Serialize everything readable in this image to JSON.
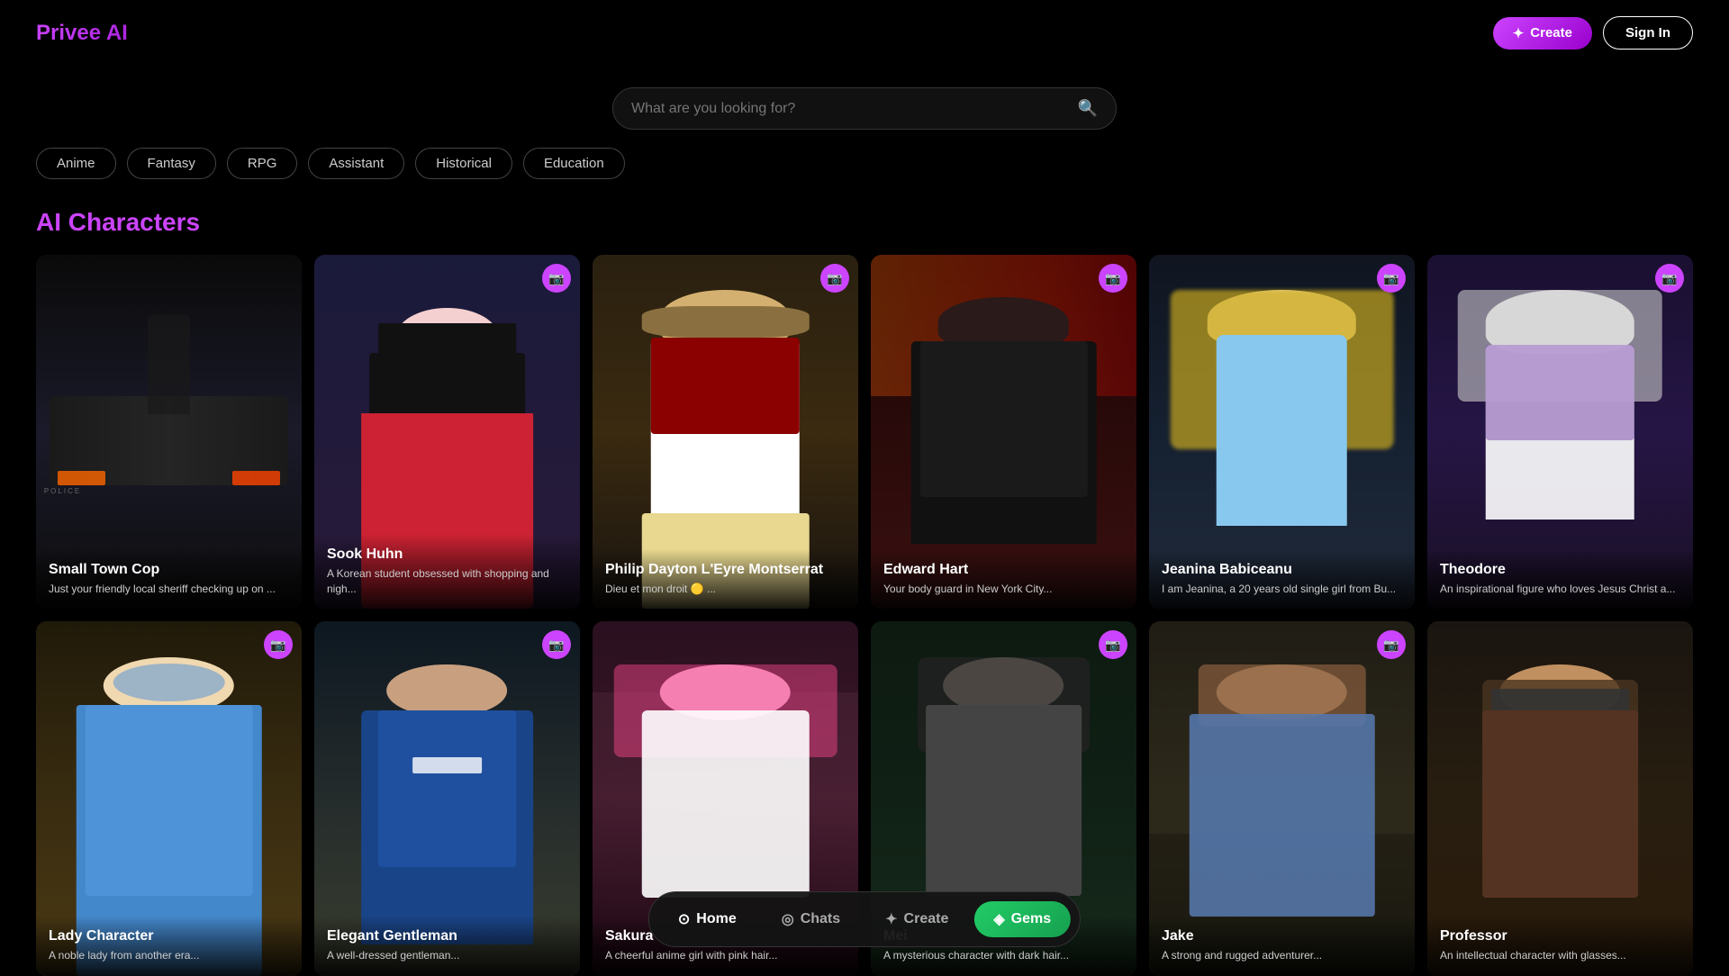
{
  "app": {
    "title": "Privee AI"
  },
  "header": {
    "logo": "Privee AI",
    "create_label": "Create",
    "sign_in_label": "Sign In"
  },
  "search": {
    "placeholder": "What are you looking for?"
  },
  "filters": [
    {
      "id": "anime",
      "label": "Anime"
    },
    {
      "id": "fantasy",
      "label": "Fantasy"
    },
    {
      "id": "rpg",
      "label": "RPG"
    },
    {
      "id": "assistant",
      "label": "Assistant"
    },
    {
      "id": "historical",
      "label": "Historical"
    },
    {
      "id": "education",
      "label": "Education"
    }
  ],
  "section_title": "AI Characters",
  "characters_row1": [
    {
      "id": "small-town-cop",
      "name": "Small Town Cop",
      "description": "Just your friendly local sheriff checking up on ...",
      "has_camera": false,
      "bg_class": "card-bg-1"
    },
    {
      "id": "sook-huhn",
      "name": "Sook Huhn",
      "description": "A Korean student obsessed with shopping and nigh...",
      "has_camera": true,
      "bg_class": "card-bg-2"
    },
    {
      "id": "philip-dayton",
      "name": "Philip Dayton L'Eyre Montserrat",
      "description": "Dieu et mon droit 🟡 ...",
      "has_camera": true,
      "bg_class": "card-bg-3"
    },
    {
      "id": "edward-hart",
      "name": "Edward Hart",
      "description": "Your body guard in New York City...",
      "has_camera": true,
      "bg_class": "card-bg-4"
    },
    {
      "id": "jeanina-babiceanu",
      "name": "Jeanina Babiceanu",
      "description": "I am Jeanina, a 20 years old single girl from Bu...",
      "has_camera": true,
      "bg_class": "card-bg-5"
    },
    {
      "id": "theodore",
      "name": "Theodore",
      "description": "An inspirational figure who loves Jesus Christ a...",
      "has_camera": true,
      "bg_class": "card-bg-6"
    }
  ],
  "characters_row2": [
    {
      "id": "lady-period",
      "name": "Lady Character",
      "description": "A noble lady from another era...",
      "has_camera": true,
      "bg_class": "card-bg-7"
    },
    {
      "id": "suit-character",
      "name": "Elegant Gentleman",
      "description": "A well-dressed gentleman...",
      "has_camera": true,
      "bg_class": "card-bg-8"
    },
    {
      "id": "anime-girl-pink",
      "name": "Sakura",
      "description": "A cheerful anime girl with pink hair...",
      "has_camera": false,
      "bg_class": "card-bg-9"
    },
    {
      "id": "asian-girl",
      "name": "Mei",
      "description": "A mysterious character with dark hair...",
      "has_camera": true,
      "bg_class": "card-bg-10"
    },
    {
      "id": "rugged-man",
      "name": "Jake",
      "description": "A strong and rugged adventurer...",
      "has_camera": true,
      "bg_class": "card-bg-11"
    },
    {
      "id": "glasses-man",
      "name": "Professor",
      "description": "An intellectual character with glasses...",
      "has_camera": false,
      "bg_class": "card-bg-12"
    }
  ],
  "bottom_nav": [
    {
      "id": "home",
      "label": "Home",
      "icon": "⊙",
      "active": true
    },
    {
      "id": "chats",
      "label": "Chats",
      "icon": "◎",
      "active": false
    },
    {
      "id": "create",
      "label": "Create",
      "icon": "✦",
      "active": false
    },
    {
      "id": "gems",
      "label": "Gems",
      "icon": "◈",
      "active": false
    }
  ],
  "colors": {
    "accent": "#cc44ff",
    "gems_green": "#22cc66",
    "background": "#000000"
  }
}
